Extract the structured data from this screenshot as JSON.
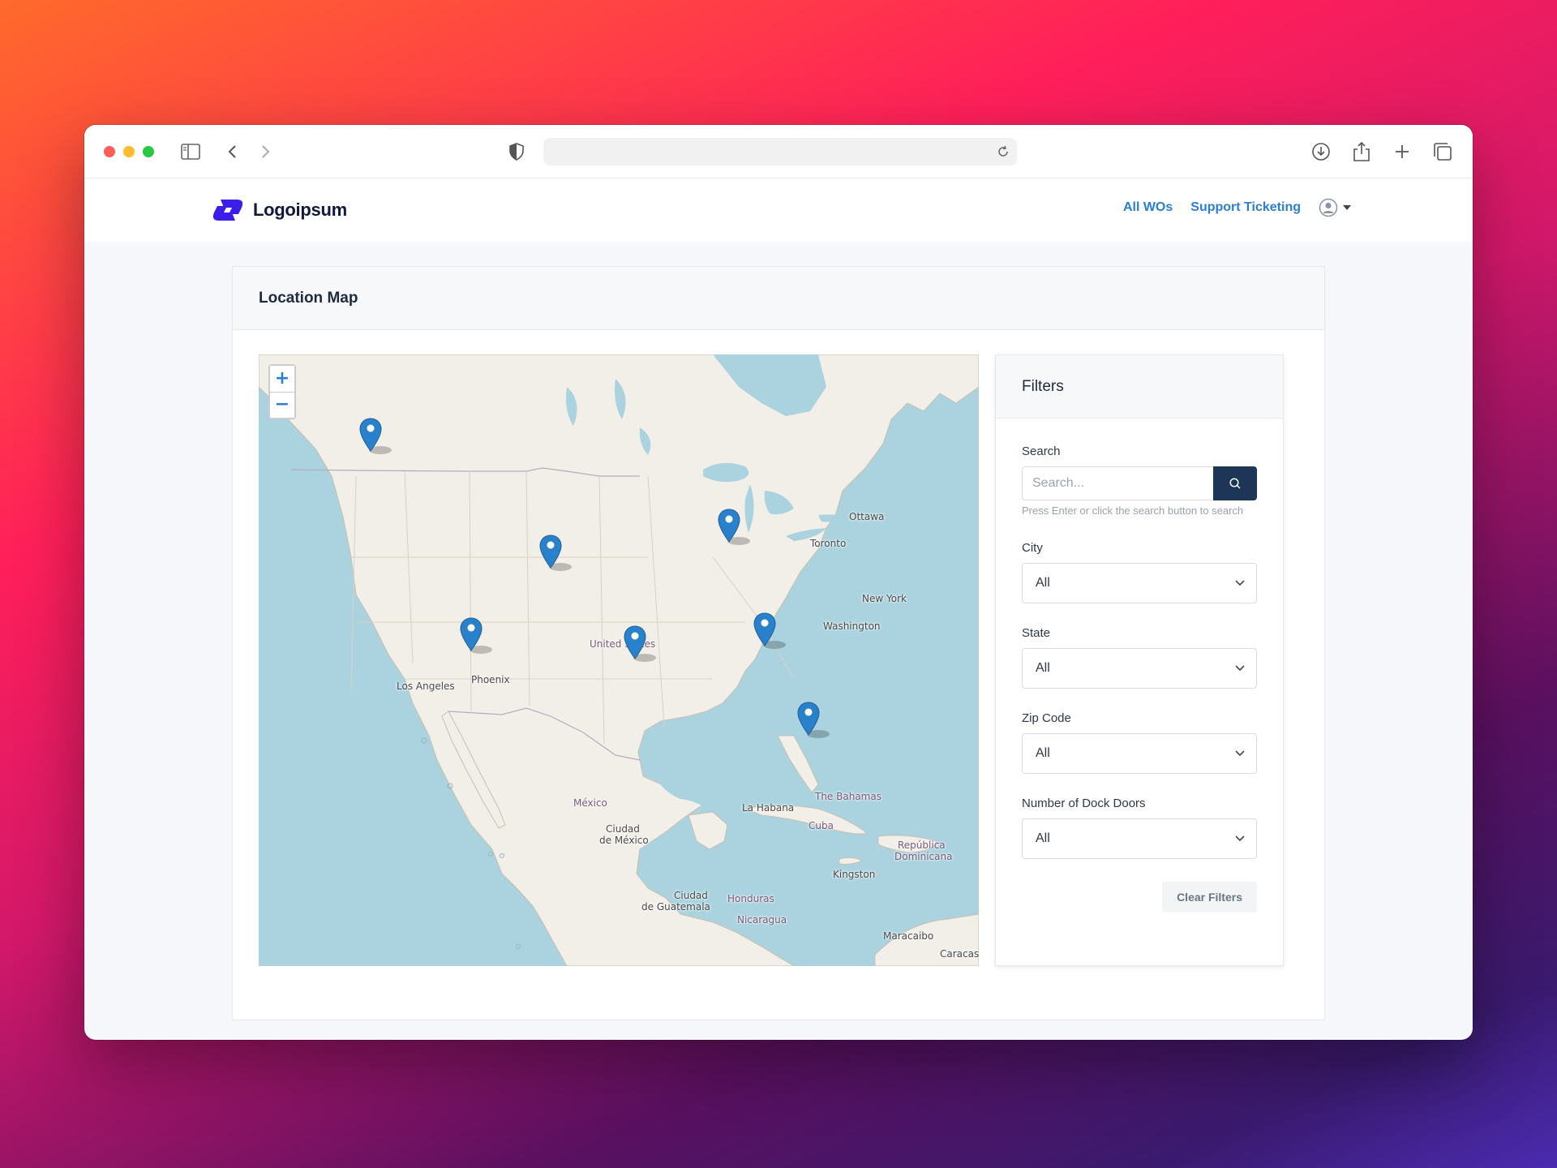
{
  "browser": {
    "url": ""
  },
  "navbar": {
    "logo_text": "Logoipsum",
    "links": [
      {
        "label": "All WOs"
      },
      {
        "label": "Support Ticketing"
      }
    ]
  },
  "page": {
    "title": "Location Map"
  },
  "map": {
    "labels": {
      "ottawa": "Ottawa",
      "toronto": "Toronto",
      "new_york": "New York",
      "washington": "Washington",
      "united_states": "United States",
      "los_angeles": "Los Angeles",
      "phoenix": "Phoenix",
      "mexico": "México",
      "ciudad_de_mexico_1": "Ciudad",
      "ciudad_de_mexico_2": "de México",
      "la_habana": "La Habana",
      "cuba": "Cuba",
      "bahamas": "The Bahamas",
      "republica_1": "República",
      "republica_2": "Dominicana",
      "kingston": "Kingston",
      "guatemala_1": "Ciudad",
      "guatemala_2": "de Guatemala",
      "honduras": "Honduras",
      "nicaragua": "Nicaragua",
      "maracaibo": "Maracaibo",
      "caracas": "Caracas"
    },
    "zoom_in": "+",
    "zoom_out": "−",
    "marker_count": 7
  },
  "filters": {
    "title": "Filters",
    "search": {
      "label": "Search",
      "placeholder": "Search...",
      "value": "",
      "hint": "Press Enter or click the search button to search"
    },
    "city": {
      "label": "City",
      "value": "All"
    },
    "state": {
      "label": "State",
      "value": "All"
    },
    "zip": {
      "label": "Zip Code",
      "value": "All"
    },
    "dock_doors": {
      "label": "Number of Dock Doors",
      "value": "All"
    },
    "clear_label": "Clear Filters"
  },
  "colors": {
    "accent": "#2a7fd4",
    "search_button": "#1d3557",
    "water": "#aad3df",
    "land": "#f2efe9",
    "marker": "#2a81cb"
  }
}
